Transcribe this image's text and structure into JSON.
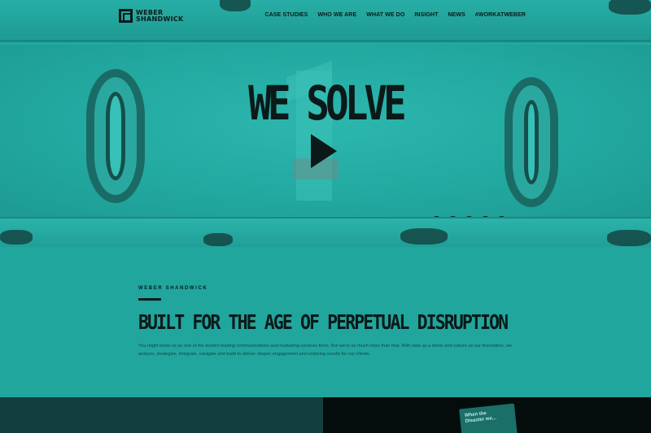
{
  "brand": {
    "line1": "WEBER",
    "line2": "SHANDWICK",
    "icon": "weber-shandwick-logo-mark"
  },
  "nav": {
    "items": [
      "CASE STUDIES",
      "WHO WE ARE",
      "WHAT WE DO",
      "INSIGHT",
      "NEWS",
      "#WORKATWEBER"
    ]
  },
  "hero": {
    "title": "WE SOLVE",
    "play_icon": "play-icon"
  },
  "social": {
    "icons": [
      {
        "name": "youtube-icon",
        "glyph": "▶"
      },
      {
        "name": "twitter-icon",
        "glyph": "t"
      },
      {
        "name": "facebook-icon",
        "glyph": "f"
      },
      {
        "name": "linkedin-icon",
        "glyph": "in"
      },
      {
        "name": "instagram-icon",
        "glyph": "◎"
      }
    ]
  },
  "intro": {
    "eyebrow": "WEBER SHANDWICK",
    "title": "BUILT FOR THE AGE OF PERPETUAL DISRUPTION",
    "body": "You might know us as one of the world's leading communications and marketing services firms. But we're so much more than that. With data as a driver and culture as our foundation, we analyze, strategize, integrate, navigate and build to deliver deeper engagement and enduring results for our clients."
  },
  "card": {
    "text_line1": "When the",
    "text_line2": "Disaster we..."
  },
  "colors": {
    "accent": "#22a9a0",
    "dark": "#0b1a19",
    "band_left": "#123f3d",
    "band_right": "#050d0c"
  }
}
